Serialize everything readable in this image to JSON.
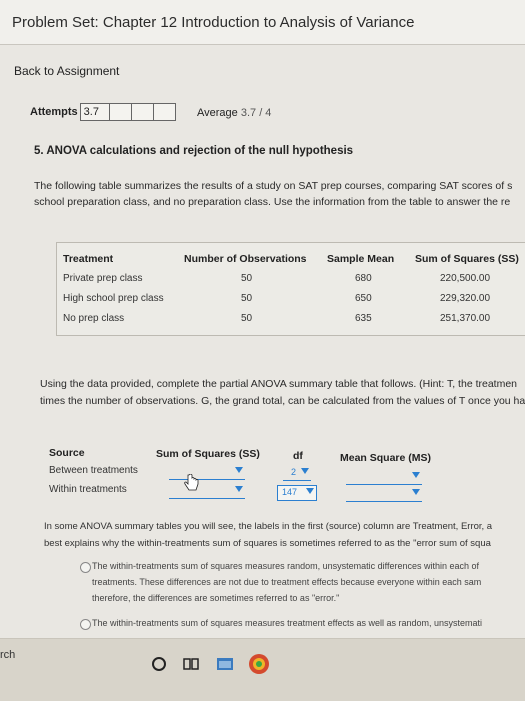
{
  "page_title": "Problem Set: Chapter 12 Introduction to Analysis of Variance",
  "back_link": "Back to Assignment",
  "attempts": {
    "label": "Attempts",
    "value": "3.7"
  },
  "average": {
    "label": "Average",
    "value": "3.7 / 4"
  },
  "question": {
    "title": "5. ANOVA calculations and rejection of the null hypothesis",
    "intro_line1": "The following table summarizes the results of a study on SAT prep courses, comparing SAT scores of s",
    "intro_line2": "school preparation class, and no preparation class. Use the information from the table to answer the re"
  },
  "summary_table": {
    "headers": [
      "Treatment",
      "Number of Observations",
      "Sample Mean",
      "Sum of Squares (SS)"
    ],
    "rows": [
      [
        "Private prep class",
        "50",
        "680",
        "220,500.00"
      ],
      [
        "High school prep class",
        "50",
        "650",
        "229,320.00"
      ],
      [
        "No prep class",
        "50",
        "635",
        "251,370.00"
      ]
    ]
  },
  "instructions": {
    "line1": "Using the data provided, complete the partial ANOVA summary table that follows. (Hint: T, the treatmen",
    "line2": "times the number of observations. G, the grand total, can be calculated from the values of T once you ha"
  },
  "anova_table": {
    "headers": [
      "Source",
      "Sum of Squares (SS)",
      "df",
      "Mean Square (MS)"
    ],
    "rows": [
      "Between treatments",
      "Within treatments"
    ],
    "df_between": "2",
    "df_within": "147"
  },
  "followup": {
    "line1": "In some ANOVA summary tables you will see, the labels in the first (source) column are Treatment, Error, a",
    "line2": "best explains why the within-treatments sum of squares is sometimes referred to as the \"error sum of squa",
    "option1_line1": "The within-treatments sum of squares measures random, unsystematic differences within each of",
    "option1_line2": "treatments. These differences are not due to treatment effects because everyone within each sam",
    "option1_line3": "therefore, the differences are sometimes referred to as \"error.\"",
    "option2_line1": "The within-treatments sum of squares measures treatment effects as well as random, unsystemati"
  },
  "taskbar": {
    "search_fragment": "rch"
  },
  "colors": {
    "accent": "#2b7fd0",
    "page_bg": "#e9e7e2"
  }
}
